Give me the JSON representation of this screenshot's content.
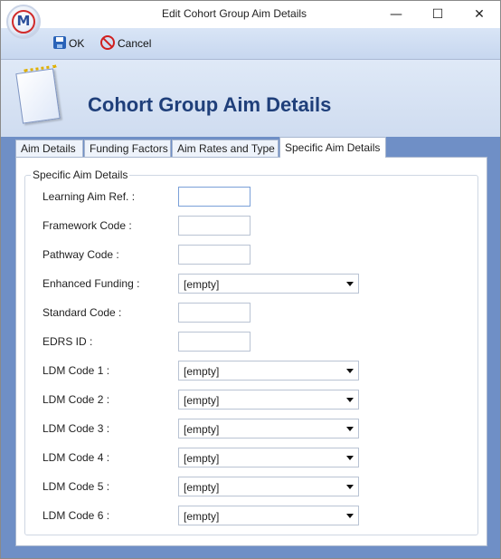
{
  "window": {
    "title": "Edit Cohort Group Aim Details",
    "logo_letter": "M"
  },
  "window_controls": {
    "minimize": "—",
    "maximize": "☐",
    "close": "✕"
  },
  "toolbar": {
    "ok_label": "OK",
    "cancel_label": "Cancel"
  },
  "header": {
    "title": "Cohort Group Aim Details"
  },
  "tabs": [
    {
      "label": "Aim Details",
      "active": false
    },
    {
      "label": "Funding Factors",
      "active": false
    },
    {
      "label": "Aim Rates and Type",
      "active": false
    },
    {
      "label": "Specific Aim Details",
      "active": true
    }
  ],
  "group": {
    "title": "Specific Aim Details",
    "fields": [
      {
        "label": "Learning Aim Ref. :",
        "type": "text",
        "value": ""
      },
      {
        "label": "Framework Code :",
        "type": "text",
        "value": ""
      },
      {
        "label": "Pathway Code :",
        "type": "text",
        "value": ""
      },
      {
        "label": "Enhanced Funding :",
        "type": "combo",
        "value": "[empty]"
      },
      {
        "label": "Standard Code :",
        "type": "text",
        "value": ""
      },
      {
        "label": "EDRS ID :",
        "type": "text",
        "value": ""
      },
      {
        "label": "LDM Code 1 :",
        "type": "combo",
        "value": "[empty]"
      },
      {
        "label": "LDM Code 2 :",
        "type": "combo",
        "value": "[empty]"
      },
      {
        "label": "LDM Code 3 :",
        "type": "combo",
        "value": "[empty]"
      },
      {
        "label": "LDM Code 4 :",
        "type": "combo",
        "value": "[empty]"
      },
      {
        "label": "LDM Code 5 :",
        "type": "combo",
        "value": "[empty]"
      },
      {
        "label": "LDM Code 6 :",
        "type": "combo",
        "value": "[empty]"
      }
    ]
  }
}
